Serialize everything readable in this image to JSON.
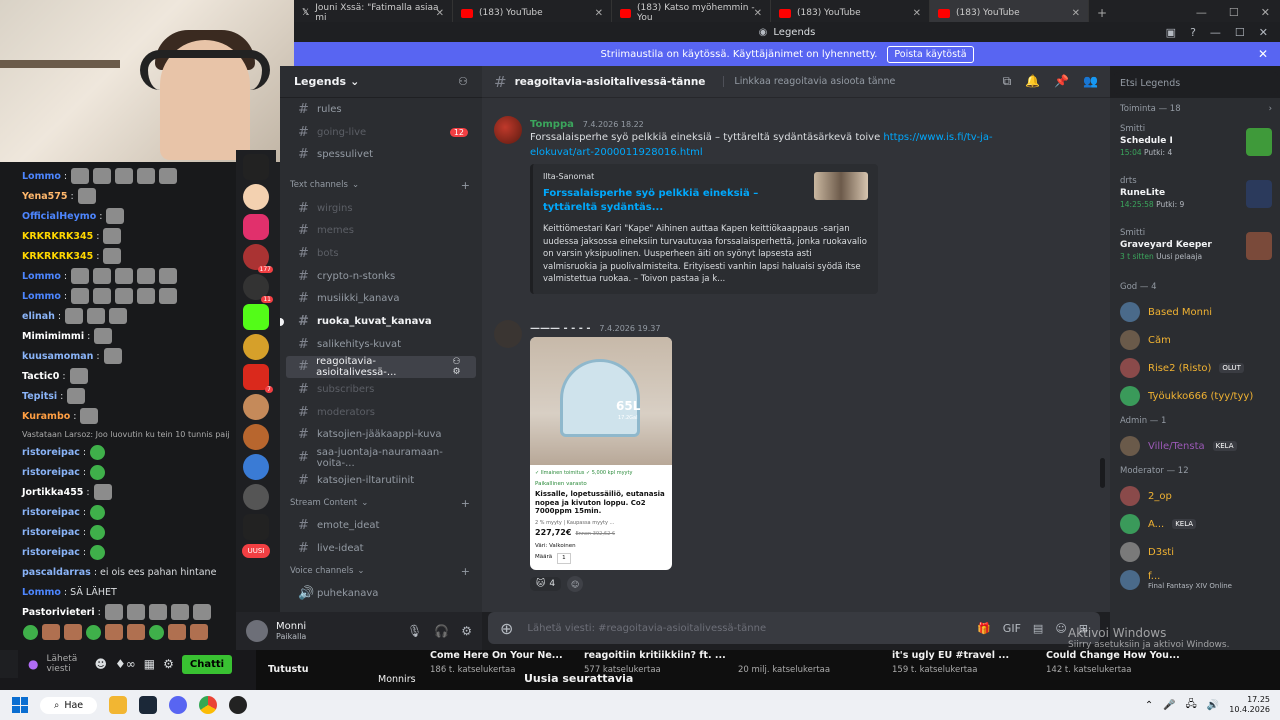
{
  "browser": {
    "tabs": [
      {
        "title": "Jouni Xssä: \"Fatimalla asiaa mi",
        "active": false,
        "icon": "x-icon"
      },
      {
        "title": "(183) YouTube",
        "active": false,
        "icon": "youtube-icon"
      },
      {
        "title": "(183) Katso myöhemmin - You",
        "active": false,
        "icon": "youtube-icon"
      },
      {
        "title": "(183) YouTube",
        "active": false,
        "icon": "youtube-icon"
      },
      {
        "title": "(183) YouTube",
        "active": true,
        "icon": "youtube-icon"
      }
    ]
  },
  "discord": {
    "app_title": "Legends",
    "banner": {
      "text": "Striimaustila on käytössä. Käyttäjänimet on lyhennetty.",
      "button": "Poista käytöstä"
    },
    "guild_name": "Legends",
    "channels": [
      {
        "name": "rules",
        "state": "normal"
      },
      {
        "name": "going-live",
        "state": "muted",
        "mention": "12"
      },
      {
        "name": "spessulivet",
        "state": "normal"
      }
    ],
    "text_category": "Text channels",
    "text_channels": [
      {
        "name": "wirgins",
        "state": "muted"
      },
      {
        "name": "memes",
        "state": "muted"
      },
      {
        "name": "bots",
        "state": "muted"
      },
      {
        "name": "crypto-n-stonks",
        "state": "normal"
      },
      {
        "name": "musiikki_kanava",
        "state": "normal"
      },
      {
        "name": "ruoka_kuvat_kanava",
        "state": "unread"
      },
      {
        "name": "salikehitys-kuvat",
        "state": "normal"
      },
      {
        "name": "reagoitavia-asioitalivessä-...",
        "state": "active"
      },
      {
        "name": "subscribers",
        "state": "muted"
      },
      {
        "name": "moderators",
        "state": "muted"
      },
      {
        "name": "katsojien-jääkaappi-kuva",
        "state": "normal"
      },
      {
        "name": "saa-juontaja-nauramaan-voita-...",
        "state": "normal"
      },
      {
        "name": "katsojien-iltarutiinit",
        "state": "normal"
      }
    ],
    "stream_category": "Stream Content",
    "stream_channels": [
      {
        "name": "emote_ideat"
      },
      {
        "name": "live-ideat"
      }
    ],
    "voice_category": "Voice channels",
    "voice_channels": [
      {
        "name": "puhekanava"
      }
    ],
    "user": {
      "name": "Monni",
      "status": "Paikalla"
    },
    "server_badges": [
      "2",
      "177",
      "11",
      "7",
      "UUSI"
    ],
    "header": {
      "channel": "reagoitavia-asioitalivessä-tänne",
      "topic": "Linkkaa reagoitavia asioota tänne"
    },
    "search_placeholder": "Etsi Legends",
    "messages": [
      {
        "author": "Tomppa",
        "author_color": "#3ba55c",
        "time": "7.4.2026 18.22",
        "text": "Forssalaisperhe syö pelkkiä eineksiä – tyttäreltä sydäntäsärkevä toive ",
        "link": "https://www.is.fi/tv-ja-elokuvat/art-2000011928016.html",
        "embed": {
          "provider": "Ilta-Sanomat",
          "title": "Forssalaisperhe syö pelkkiä eineksiä – tyttäreltä sydäntäs...",
          "description": "Keittiömestari Kari \"Kape\" Aihinen auttaa Kapen keittiökaappaus -sarjan uudessa jaksossa eineksiin turvautuvaa forssalaisperhettä, jonka ruokavalio on varsin yksipuolinen. Uusperheen äiti on syönyt lapsesta asti valmisruokia ja puolivalmisteita. Erityisesti vanhin lapsi haluaisi syödä itse valmistettua ruokaa. – Toivon pastaa ja k..."
        }
      },
      {
        "author": "——— - - - -",
        "time": "7.4.2026 19.37",
        "image": {
          "volume": "65L",
          "volume_sub": "17.2Gal",
          "badges": "✓ Ilmainen toimitus   ✓ 5,000 kpl myyty",
          "store": "Paikallinen varasto",
          "title": "Kissalle, lopetussäiliö, eutanasia nopea ja kivuton loppu. Co2 7000ppm 15min.",
          "sold": "2 % myyty | Kaupassa myyty ...",
          "price": "227,72€",
          "old_price": "Ennen 392,62 €",
          "color_label": "Väri: Valkoinen",
          "qty_label": "Määrä",
          "qty": "1"
        },
        "reaction_count": "4"
      }
    ],
    "composer_placeholder": "Lähetä viesti: #reagoitavia-asioitalivessä-tänne",
    "members": {
      "activity_header": "Toiminta — 18",
      "activities": [
        {
          "user": "Smitti",
          "game": "Schedule I",
          "detail1": "15:04",
          "detail2": "Putki: 4",
          "color": "#3f9a3a"
        },
        {
          "user": "drts",
          "game": "RuneLite",
          "detail1": "14:25:58",
          "detail2": "Putki: 9",
          "color": "#2b3a5c"
        },
        {
          "user": "Smitti",
          "game": "Graveyard Keeper",
          "detail1": "3 t sitten",
          "detail2": "Uusi pelaaja",
          "color": "#7a4a3a"
        }
      ],
      "groups": [
        {
          "title": "God — 4",
          "members": [
            {
              "name": "Based Monni",
              "color": "#f0b232",
              "tag": ""
            },
            {
              "name": "Căm",
              "color": "#f0b232",
              "tag": ""
            },
            {
              "name": "Rise2 (Risto)",
              "color": "#f0b232",
              "tag": "OLUT"
            },
            {
              "name": "Työukko666 (tyy/tyy)",
              "color": "#f0b232",
              "tag": ""
            }
          ]
        },
        {
          "title": "Admin — 1",
          "members": [
            {
              "name": "Ville/Tensta",
              "color": "#9b59b6",
              "tag": "KELA"
            }
          ]
        },
        {
          "title": "Moderator — 12",
          "members": [
            {
              "name": "2_op",
              "color": "#f0b232",
              "tag": ""
            },
            {
              "name": "A...",
              "color": "#f0b232",
              "tag": "KELA"
            },
            {
              "name": "D3sti",
              "color": "#f0b232",
              "tag": ""
            },
            {
              "name": "f...",
              "color": "#f0b232",
              "tag": "",
              "sub": "Final Fantasy XIV Online"
            }
          ]
        }
      ]
    }
  },
  "stream_chat": {
    "lines": [
      {
        "user": "Lommo",
        "color": "#4d86ff",
        "text": "",
        "emotes": 5
      },
      {
        "user": "Yena575",
        "color": "#ffb86c",
        "text": "",
        "emotes": 1
      },
      {
        "user": "OfficialHeymo",
        "color": "#4d86ff",
        "text": "",
        "emotes": 1
      },
      {
        "user": "KRKRKRK345",
        "color": "#ffd700",
        "text": "",
        "emotes": 1
      },
      {
        "user": "KRKRKRK345",
        "color": "#ffd700",
        "text": "",
        "emotes": 1
      },
      {
        "user": "Lommo",
        "color": "#4d86ff",
        "text": "",
        "emotes": 5
      },
      {
        "user": "Lommo",
        "color": "#4d86ff",
        "text": "",
        "emotes": 5
      },
      {
        "user": "elinah",
        "color": "#8ab4f8",
        "text": "",
        "emotes": 3
      },
      {
        "user": "Mimimimmi",
        "color": "#ffffff",
        "text": "",
        "emotes": 1
      },
      {
        "user": "kuusamoman",
        "color": "#8ab4f8",
        "text": "",
        "emotes": 1
      },
      {
        "user": "Tactic0",
        "color": "#ffffff",
        "text": "",
        "emotes": 1
      },
      {
        "user": "Tepitsi",
        "color": "#8ab4f8",
        "text": "",
        "emotes": 1
      },
      {
        "user": "Kurambo",
        "color": "#ff9f43",
        "text": "",
        "emotes": 1
      }
    ],
    "reply": "Vastataan Larsoz: Joo luovutin ku tein 10 tunnis paij",
    "lines2": [
      {
        "user": "ristoreipac",
        "color": "#8ab4f8",
        "text": "",
        "emotes": 1,
        "green": true
      },
      {
        "user": "ristoreipac",
        "color": "#8ab4f8",
        "text": "",
        "emotes": 1,
        "green": true
      },
      {
        "user": "Jortikka455",
        "color": "#ffffff",
        "text": "",
        "emotes": 1
      },
      {
        "user": "ristoreipac",
        "color": "#8ab4f8",
        "text": "",
        "emotes": 1,
        "green": true
      },
      {
        "user": "ristoreipac",
        "color": "#8ab4f8",
        "text": "",
        "emotes": 1,
        "green": true
      },
      {
        "user": "ristoreipac",
        "color": "#8ab4f8",
        "text": "",
        "emotes": 1,
        "green": true
      },
      {
        "user": "pascaldarras",
        "color": "#8ab4f8",
        "text": "ei ois ees pahan hintane",
        "emotes": 0
      },
      {
        "user": "Lommo",
        "color": "#4d86ff",
        "text": "SÄ LÄHET",
        "emotes": 0
      },
      {
        "user": "Pastorivieteri",
        "color": "#ffffff",
        "text": "",
        "emotes": 5
      }
    ],
    "input_placeholder": "Lähetä viesti",
    "chat_button": "Chatti"
  },
  "youtube": {
    "tab_label": "Tutustu",
    "channel_name": "Monnirs",
    "section": "Uusia seurattavia",
    "videos": [
      {
        "title": "Come Here On Your Ne...",
        "views": "186 t. katselukertaa"
      },
      {
        "title": "reagoitiin kritiikkiin? ft. ...",
        "views": "577 katselukertaa"
      },
      {
        "title": "",
        "views": "20 milj. katselukertaa"
      },
      {
        "title": "it's ugly EU #travel ...",
        "views": "159 t. katselukertaa"
      },
      {
        "title": "Could Change How You...",
        "views": "142 t. katselukertaa"
      }
    ]
  },
  "watermark": {
    "line1": "Aktivoi Windows",
    "line2": "Siirry asetuksiin ja aktivoi Windows."
  },
  "taskbar": {
    "search": "Hae",
    "time": "17.25",
    "date": "10.4.2026"
  }
}
